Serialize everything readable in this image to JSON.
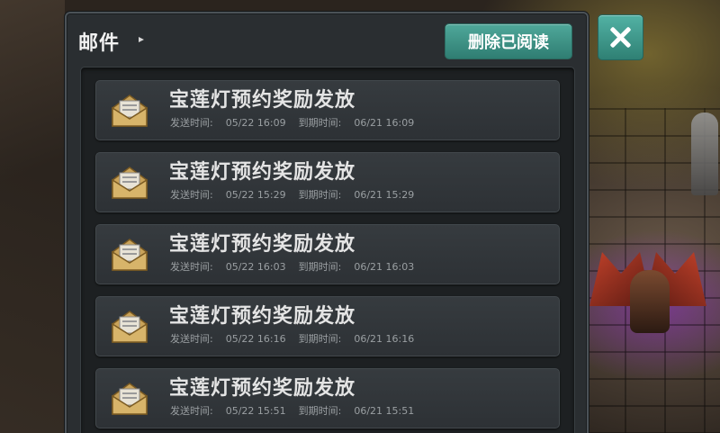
{
  "window": {
    "title": "邮件",
    "delete_read_label": "删除已阅读"
  },
  "mails": [
    {
      "title": "宝莲灯预约奖励发放",
      "send_label": "发送时间:",
      "send_time": "05/22 16:09",
      "expire_label": "到期时间:",
      "expire_time": "06/21 16:09"
    },
    {
      "title": "宝莲灯预约奖励发放",
      "send_label": "发送时间:",
      "send_time": "05/22 15:29",
      "expire_label": "到期时间:",
      "expire_time": "06/21 15:29"
    },
    {
      "title": "宝莲灯预约奖励发放",
      "send_label": "发送时间:",
      "send_time": "05/22 16:03",
      "expire_label": "到期时间:",
      "expire_time": "06/21 16:03"
    },
    {
      "title": "宝莲灯预约奖励发放",
      "send_label": "发送时间:",
      "send_time": "05/22 16:16",
      "expire_label": "到期时间:",
      "expire_time": "06/21 16:16"
    },
    {
      "title": "宝莲灯预约奖励发放",
      "send_label": "发送时间:",
      "send_time": "05/22 15:51",
      "expire_label": "到期时间:",
      "expire_time": "06/21 15:51"
    }
  ],
  "icons": {
    "mail_icon": "open-envelope-icon",
    "close_icon": "close-icon",
    "title_arrow": "arrow-right-icon"
  },
  "colors": {
    "button_teal": "#3f9a8c",
    "panel_bg": "#2a2e31",
    "item_bg": "#33383c"
  }
}
